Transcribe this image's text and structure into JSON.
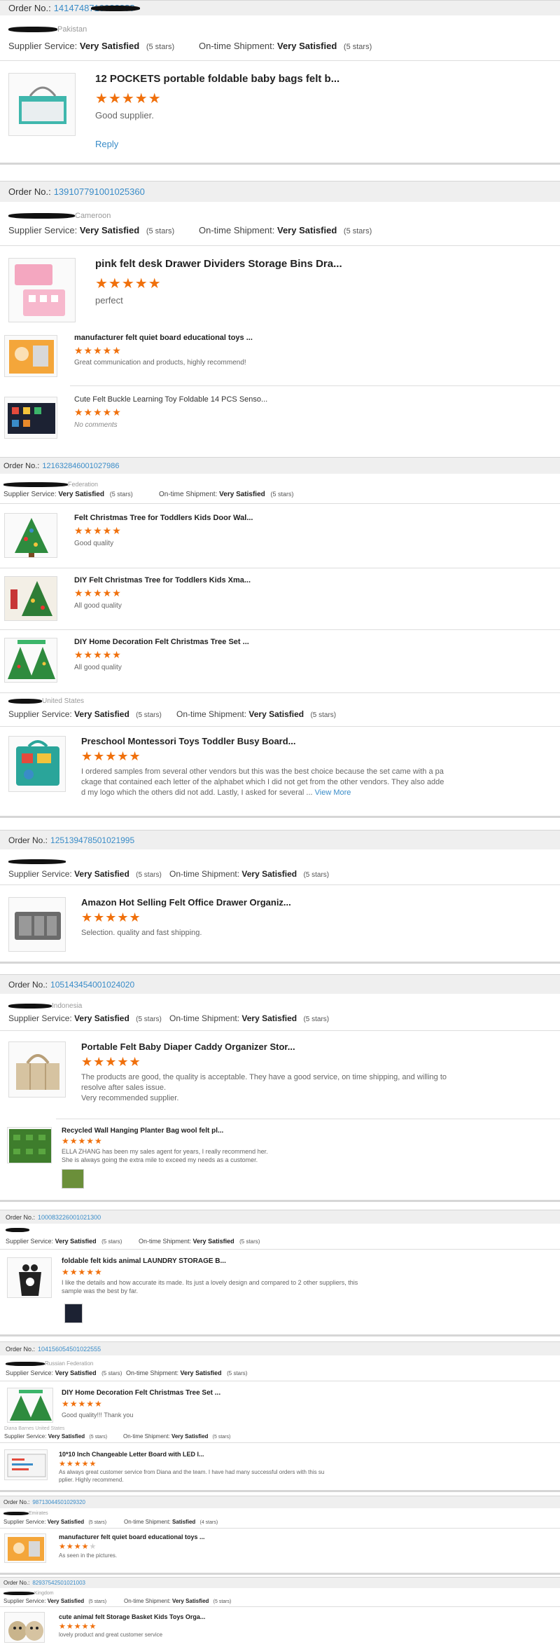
{
  "colors": {
    "link": "#3a8cc8",
    "star": "#f0700c",
    "bar": "#efefef"
  },
  "labels": {
    "order_no": "Order No.:",
    "supplier_service": "Supplier Service:",
    "ontime_shipment": "On-time Shipment:",
    "very_satisfied": "Very Satisfied",
    "satisfied": "Satisfied",
    "five_stars": "(5 stars)",
    "four_stars": "(4 stars)",
    "reply": "Reply",
    "view_more": "View More"
  },
  "reviews": [
    {
      "order_no": "14147487100?????",
      "buyer_country": "Pakistan",
      "items": [
        {
          "title": "12 POCKETS portable foldable baby bags felt b...",
          "stars": 5,
          "comment": "Good supplier.",
          "icon": "baby-bag-image"
        }
      ]
    },
    {
      "order_no": "139107791001025360",
      "buyer_country": "Cameroon",
      "items": [
        {
          "title": "pink felt desk Drawer Dividers Storage Bins Dra...",
          "stars": 5,
          "comment": "perfect",
          "icon": "pink-divider-image"
        },
        {
          "title": "manufacturer felt quiet board educational toys ...",
          "stars": 5,
          "comment": "Great communication and products, highly recommend!",
          "icon": "quiet-board-image"
        },
        {
          "title": "Cute Felt Buckle Learning Toy Foldable 14 PCS Senso...",
          "stars": 5,
          "comment": "No comments",
          "icon": "buckle-toy-image"
        }
      ]
    },
    {
      "order_no": "121632846001027986",
      "buyer_country": "Federation",
      "items": [
        {
          "title": "Felt Christmas Tree for Toddlers Kids Door Wal...",
          "stars": 5,
          "comment": "Good quality",
          "icon": "christmas-tree-image"
        },
        {
          "title": "DIY Felt Christmas Tree for Toddlers Kids Xma...",
          "stars": 5,
          "comment": "All good quality",
          "icon": "christmas-tree-image"
        },
        {
          "title": "DIY Home Decoration Felt Christmas Tree Set ...",
          "stars": 5,
          "comment": "All good quality",
          "icon": "christmas-tree-set-image"
        }
      ]
    },
    {
      "buyer_country": "United States",
      "items": [
        {
          "title": "Preschool Montessori Toys Toddler Busy Board...",
          "stars": 5,
          "comment_lines": [
            "I ordered samples from several other vendors but this was the best choice because the set came with a pa",
            "ckage that contained each letter of the alphabet which I did not get from the other vendors.  They also adde",
            "d my logo which the others did not add. Lastly, I asked for several ... "
          ],
          "icon": "busy-board-image"
        }
      ]
    },
    {
      "order_no": "125139478501021995",
      "buyer_country": "",
      "items": [
        {
          "title": "Amazon Hot Selling Felt Office Drawer Organiz...",
          "stars": 5,
          "comment": "Selection. quality and fast shipping.",
          "icon": "drawer-organizer-image"
        }
      ]
    },
    {
      "order_no": "105143454001024020",
      "buyer_country": "Indonesia",
      "items": [
        {
          "title": "Portable Felt Baby Diaper Caddy Organizer Stor...",
          "stars": 5,
          "comment_lines": [
            "The products are good, the quality is acceptable. They have a good service, on time shipping, and willing to",
            "resolve after sales issue.",
            "Very recommended supplier."
          ],
          "icon": "diaper-caddy-image"
        },
        {
          "title": "Recycled Wall Hanging Planter Bag wool felt pl...",
          "stars": 5,
          "comment_lines": [
            "ELLA ZHANG has been my sales agent for years, I really recommend her.",
            "She is always going the extra mile to exceed my needs as a customer."
          ],
          "icon": "planter-bag-image"
        }
      ]
    },
    {
      "order_no": "100083226001021300",
      "buyer_country": "",
      "items": [
        {
          "title": "foldable felt kids animal LAUNDRY STORAGE B...",
          "stars": 5,
          "comment_lines": [
            "I like the details and how accurate its made. Its just a lovely design and compared to 2 other suppliers, this",
            "sample was the best by far."
          ],
          "icon": "laundry-storage-image"
        }
      ]
    },
    {
      "order_no": "104156054501022555",
      "buyer_country": "Russian Federation",
      "items": [
        {
          "title": "DIY Home Decoration Felt Christmas Tree Set ...",
          "stars": 5,
          "comment": "Good quality!!! Thank you",
          "icon": "christmas-tree-set-image"
        }
      ]
    },
    {
      "buyer_country": "Diana Barnes United States",
      "items": [
        {
          "title": "10*10 Inch Changeable Letter Board with LED l...",
          "stars": 5,
          "comment_lines": [
            "As always great customer service from Diana and the team. I have had many successful orders with this su",
            "pplier. Highly recommend."
          ],
          "icon": "letter-board-image"
        }
      ]
    },
    {
      "order_no": "98713044501029320",
      "buyer_country": "Emirates",
      "shipment": "Satisfied",
      "shipment_stars": "(4 stars)",
      "items": [
        {
          "title": "manufacturer felt quiet board educational toys ...",
          "stars": 4,
          "comment": "As seen in the pictures.",
          "icon": "quiet-board-image"
        }
      ]
    },
    {
      "order_no": "82937542501021003",
      "buyer_country": "Kingdom",
      "items": [
        {
          "title": "cute animal felt Storage Basket Kids Toys Orga...",
          "stars": 5,
          "comment": "lovely product and great customer service",
          "icon": "storage-basket-image"
        }
      ]
    }
  ]
}
